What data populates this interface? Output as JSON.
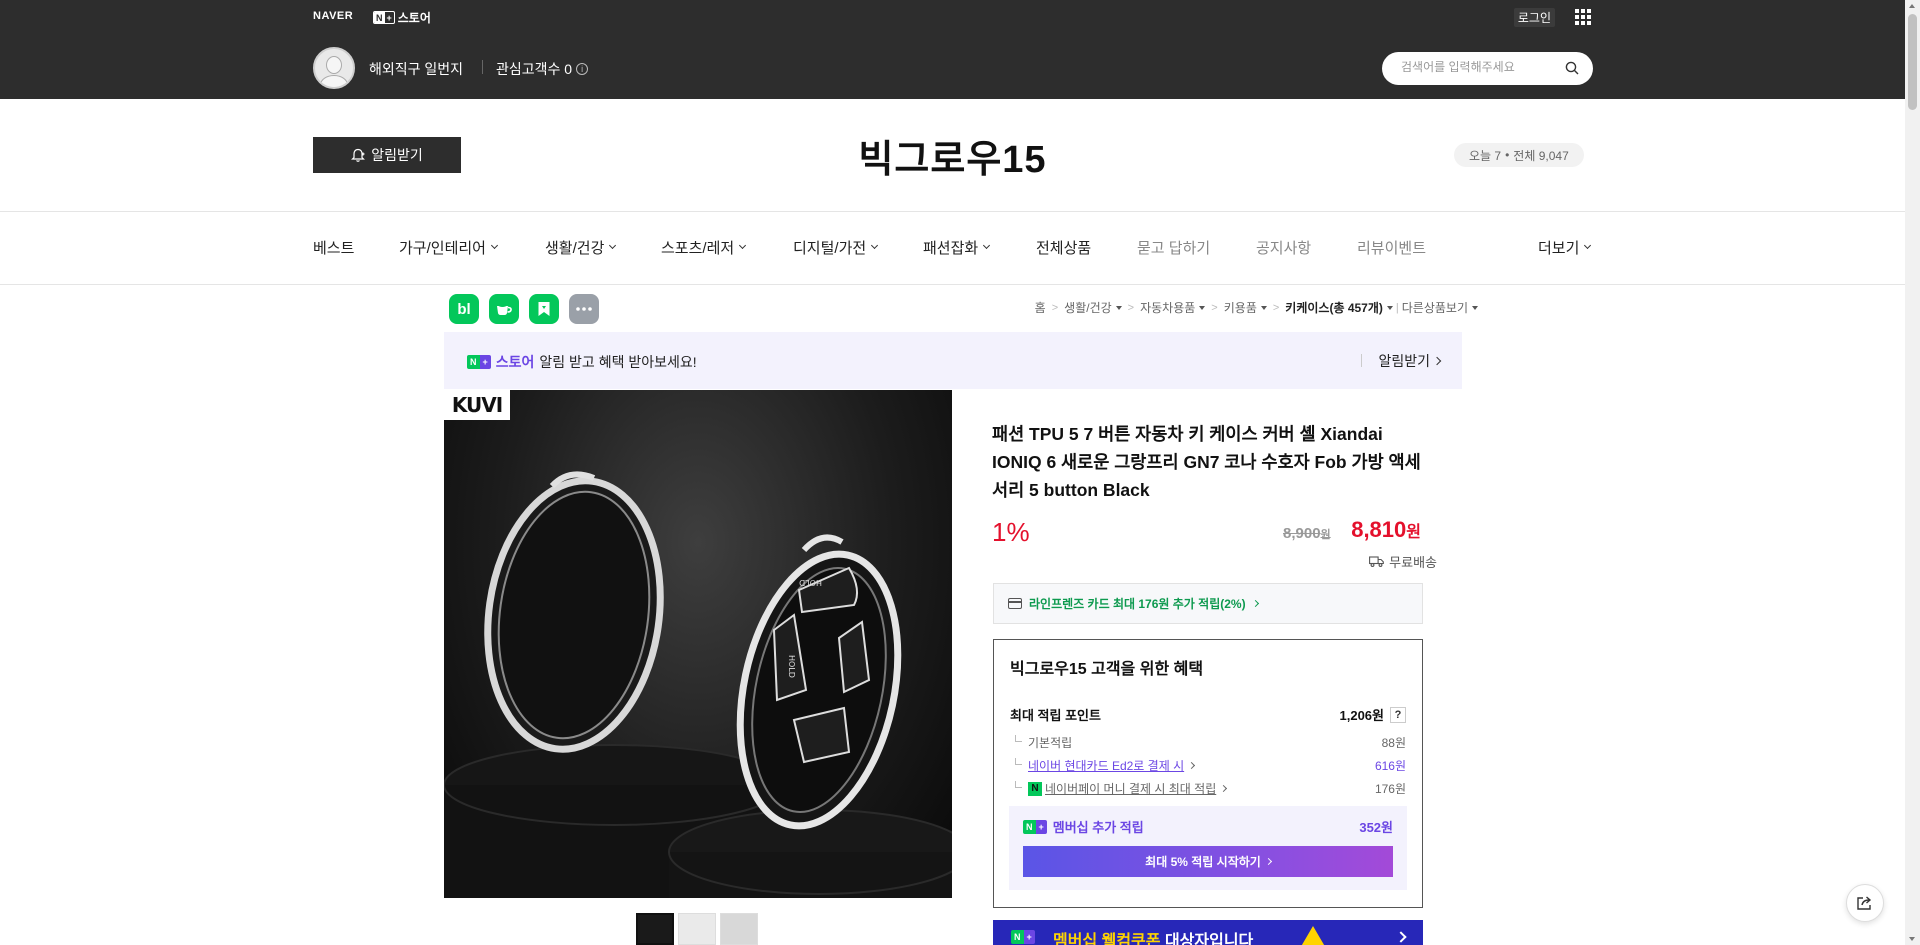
{
  "top_bar": {
    "naver_logo": "NAVER",
    "store_logo_badge_n": "N",
    "store_logo_badge_plus": "+",
    "store_logo_text": "스토어",
    "login_label": "로그인"
  },
  "seller": {
    "name": "해외직구 일번지",
    "interest_label": "관심고객수 0",
    "info_symbol": "i"
  },
  "search": {
    "placeholder": "검색어를 입력해주세요",
    "value": ""
  },
  "header": {
    "alert_button_label": "알림받기",
    "store_title": "빅그로우15",
    "visits_today": "오늘 7",
    "visits_dot": "•",
    "visits_total": "전체 9,047"
  },
  "category_nav": {
    "items": [
      {
        "label": "베스트",
        "dropdown": false,
        "muted": false
      },
      {
        "label": "가구/인테리어",
        "dropdown": true,
        "muted": false
      },
      {
        "label": "생활/건강",
        "dropdown": true,
        "muted": false
      },
      {
        "label": "스포츠/레저",
        "dropdown": true,
        "muted": false
      },
      {
        "label": "디지털/가전",
        "dropdown": true,
        "muted": false
      },
      {
        "label": "패션잡화",
        "dropdown": true,
        "muted": false
      },
      {
        "label": "전체상품",
        "dropdown": false,
        "muted": false
      },
      {
        "label": "묻고 답하기",
        "dropdown": false,
        "muted": true
      },
      {
        "label": "공지사항",
        "dropdown": false,
        "muted": true
      },
      {
        "label": "리뷰이벤트",
        "dropdown": false,
        "muted": true
      }
    ],
    "more_label": "더보기"
  },
  "share_icons": [
    {
      "icon": "blog-icon",
      "glyph": "bl",
      "color": "#03c75a"
    },
    {
      "icon": "cafe-icon",
      "glyph": "☕",
      "color": "#03c75a"
    },
    {
      "icon": "bookmark-icon",
      "glyph": "✦",
      "color": "#03c75a"
    },
    {
      "icon": "more-icon",
      "glyph": "•••",
      "color": "#9aa0a8"
    }
  ],
  "breadcrumb": {
    "home": "홈",
    "sep": ">",
    "c1": "생활/건강",
    "c2": "자동차용품",
    "c3": "키용품",
    "c4": "키케이스(총 457개)",
    "other": "다른상품보기"
  },
  "notice": {
    "badge_n": "N",
    "badge_plus": "+",
    "store_text": "스토어",
    "message": "알림 받고 혜택 받아보세요!",
    "action_label": "알림받기"
  },
  "product": {
    "brand_mark": "KUVI",
    "title": "패션 TPU 5 7 버튼 자동차 키 케이스 커버 셸 Xiandai IONIQ 6 새로운 그랑프리 GN7 코나 수호자 Fob 가방 액세서리 5 button Black",
    "discount": "1%",
    "original_price": "8,900",
    "original_currency": "원",
    "sale_price": "8,810",
    "sale_currency": "원",
    "delivery": "무료배송",
    "card_promo": "라인프렌즈 카드 최대 176원 추가 적립(2%)"
  },
  "benefits": {
    "title": "빅그로우15 고객을 위한 혜택",
    "max_points_label": "최대 적립 포인트",
    "max_points_value": "1,206원",
    "help_symbol": "?",
    "rows": [
      {
        "label": "기본적립",
        "value": "88원",
        "link": false,
        "purple": false,
        "npay": false
      },
      {
        "label": "네이버 현대카드 Ed2로 결제 시",
        "value": "616원",
        "link": true,
        "purple": true,
        "npay": false
      },
      {
        "label": "네이버페이 머니 결제 시 최대 적립",
        "value": "176원",
        "link": true,
        "purple": false,
        "npay": true
      }
    ],
    "npay_glyph": "N",
    "membership_badge_n": "N",
    "membership_badge_plus": "+",
    "membership_label": "멤버십 추가 적립",
    "membership_value": "352원",
    "membership_button": "최대 5% 적립 시작하기"
  },
  "coupon_banner": {
    "badge_n": "N",
    "badge_plus": "+",
    "text_highlight": "멤버십 웰컴쿠폰",
    "text_rest": " 대상자입니다"
  },
  "colors": {
    "accent_red": "#e4102c",
    "naver_green": "#03c75a",
    "membership_purple": "#6b46e4",
    "top_bar": "#2d2d2d"
  }
}
